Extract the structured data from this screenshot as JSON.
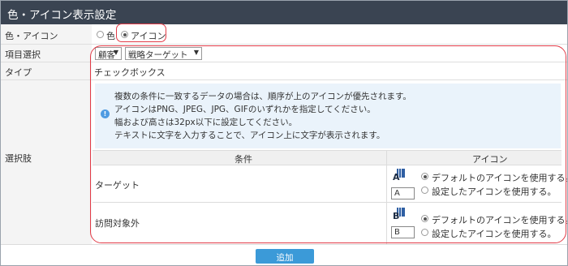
{
  "window": {
    "title": "色・アイコン表示設定"
  },
  "rows": {
    "color_icon": {
      "label": "色・アイコン",
      "options": [
        {
          "label": "色",
          "selected": false
        },
        {
          "label": "アイコン",
          "selected": true
        }
      ]
    },
    "item_selection": {
      "label": "項目選択",
      "select1": "顧客",
      "select2": "戦略ターゲット"
    },
    "type": {
      "label": "タイプ",
      "value": "チェックボックス"
    },
    "choices": {
      "label": "選択肢",
      "note_lines": [
        "複数の条件に一致するデータの場合は、順序が上のアイコンが優先されます。",
        "アイコンはPNG、JPEG、JPG、GIFのいずれかを指定してください。",
        "幅および高さは32px以下に設定してください。",
        "テキストに文字を入力することで、アイコン上に文字が表示されます。"
      ],
      "table": {
        "headers": {
          "condition": "条件",
          "icon": "アイコン"
        },
        "rows": [
          {
            "condition": "ターゲット",
            "icon_letter": "A",
            "text_value": "A",
            "options": [
              {
                "label": "デフォルトのアイコンを使用する。",
                "selected": true
              },
              {
                "label": "設定したアイコンを使用する。",
                "selected": false
              }
            ]
          },
          {
            "condition": "訪問対象外",
            "icon_letter": "B",
            "text_value": "B",
            "options": [
              {
                "label": "デフォルトのアイコンを使用する。",
                "selected": true
              },
              {
                "label": "設定したアイコンを使用する。",
                "selected": false
              }
            ]
          }
        ]
      }
    }
  },
  "footer": {
    "add_label": "追加"
  },
  "colors": {
    "titlebar": "#3a4452",
    "highlight": "#e23b47",
    "accent_button": "#3b9ad8",
    "note_bg": "#eaf3fb"
  },
  "icons": {
    "info": "info-icon",
    "select_arrow": "caret-down-icon",
    "building": "building-icon"
  }
}
